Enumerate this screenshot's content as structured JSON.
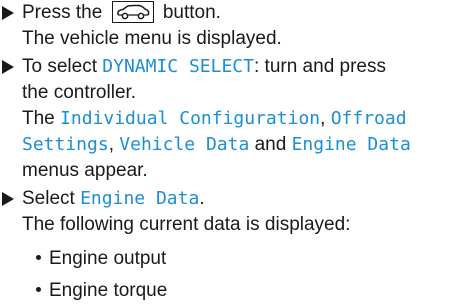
{
  "steps": [
    {
      "lines": [
        {
          "before": "Press the ",
          "icon": "car-icon",
          "after": " button."
        },
        {
          "text": "The vehicle menu is displayed."
        }
      ]
    },
    {
      "lines": [
        {
          "before": "To select ",
          "kw": "DYNAMIC SELECT",
          "after": ": turn and press"
        },
        {
          "text": "the controller."
        },
        {
          "before": "The ",
          "kw1": "Individual Configuration",
          "mid": ", ",
          "kw2": "Offroad"
        },
        {
          "kw1": "Settings",
          "mid1": ", ",
          "kw2": "Vehicle Data",
          "mid2": " and ",
          "kw3": "Engine Data"
        },
        {
          "text": "menus appear."
        }
      ]
    },
    {
      "lines": [
        {
          "before": "Select ",
          "kw": "Engine Data",
          "after": "."
        },
        {
          "text": "The following current data is displayed:"
        }
      ]
    }
  ],
  "bullets": [
    "Engine output",
    "Engine torque"
  ],
  "colors": {
    "keyword": "#1a8fd6",
    "text": "#1a1a1a"
  }
}
